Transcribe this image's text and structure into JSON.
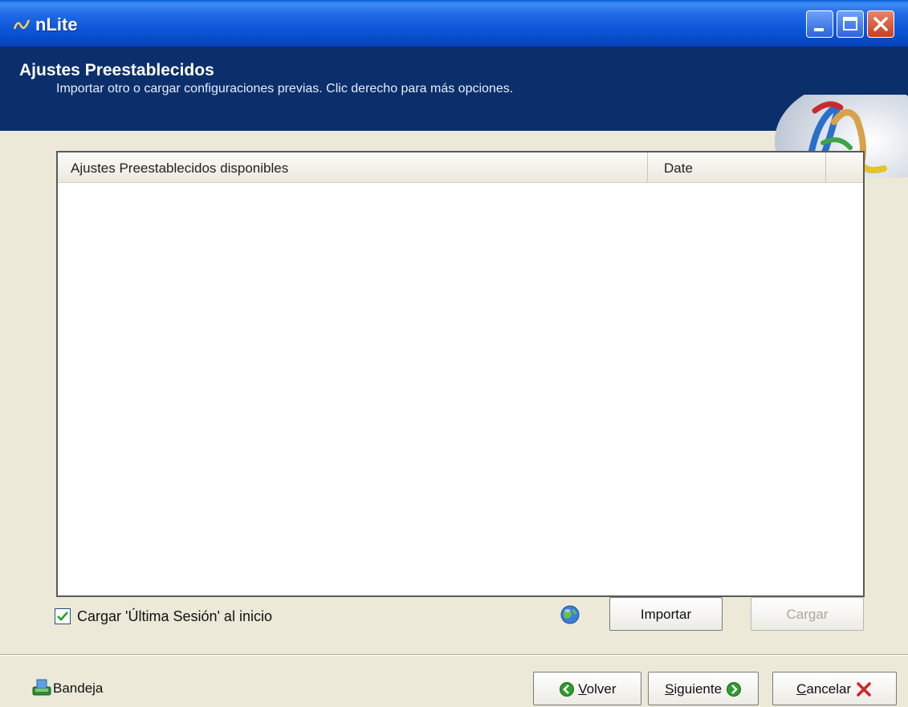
{
  "window": {
    "title": "nLite"
  },
  "header": {
    "title": "Ajustes Preestablecidos",
    "subtitle": "Importar otro o cargar configuraciones previas. Clic derecho para más opciones."
  },
  "list": {
    "columns": [
      "Ajustes Preestablecidos disponibles",
      "Date",
      ""
    ],
    "rows": []
  },
  "options": {
    "load_last_session_label": "Cargar 'Última Sesión' al inicio",
    "load_last_session_checked": true
  },
  "actions": {
    "import_label": "Importar",
    "load_label": "Cargar"
  },
  "footer": {
    "tray_label": "Bandeja",
    "back_label": "Volver",
    "next_label": "Siguiente",
    "cancel_label": "Cancelar"
  },
  "colors": {
    "titlebar": "#0a52d6",
    "banner": "#0b2f6b",
    "window_bg": "#ece9d8"
  }
}
